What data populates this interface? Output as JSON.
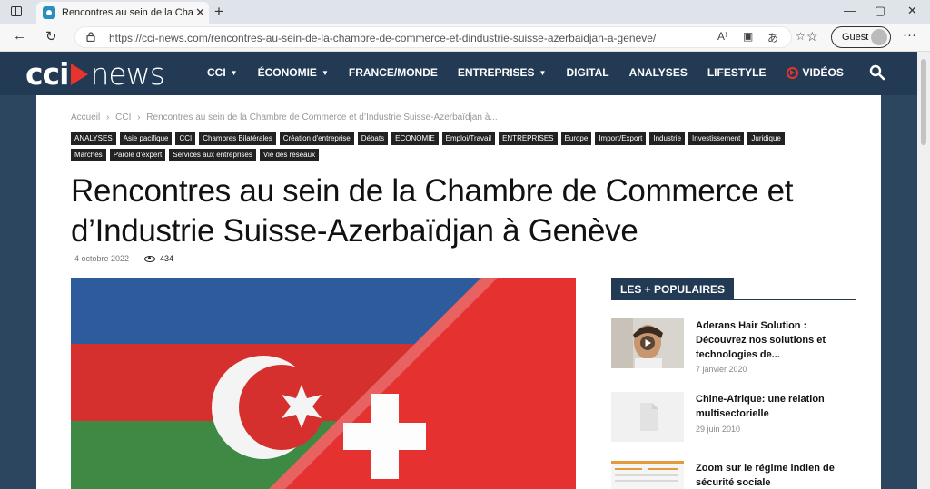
{
  "browser": {
    "tab_title": "Rencontres au sein de la Chambr",
    "url": "https://cci-news.com/rencontres-au-sein-de-la-chambre-de-commerce-et-dindustrie-suisse-azerbaidjan-a-geneve/",
    "profile_label": "Guest"
  },
  "site": {
    "logo_cci": "cci",
    "logo_news": "news",
    "menu": [
      {
        "label": "CCI",
        "dropdown": true
      },
      {
        "label": "ÉCONOMIE",
        "dropdown": true
      },
      {
        "label": "FRANCE/MONDE",
        "dropdown": false
      },
      {
        "label": "ENTREPRISES",
        "dropdown": true
      },
      {
        "label": "DIGITAL",
        "dropdown": false
      },
      {
        "label": "ANALYSES",
        "dropdown": false
      },
      {
        "label": "LIFESTYLE",
        "dropdown": false
      },
      {
        "label": "VIDÉOS",
        "dropdown": false
      }
    ]
  },
  "article": {
    "breadcrumb": [
      "Accueil",
      "CCI",
      "Rencontres au sein de la Chambre de Commerce et d’Industrie Suisse-Azerbaïdjan à..."
    ],
    "breadcrumb_sep": "›",
    "tags": [
      "ANALYSES",
      "Asie pacifique",
      "CCI",
      "Chambres Bilatérales",
      "Création d'entreprise",
      "Débats",
      "ECONOMIE",
      "Emploi/Travail",
      "ENTREPRISES",
      "Europe",
      "Import/Export",
      "Industrie",
      "Investissement",
      "Juridique",
      "Marchés",
      "Parole d'expert",
      "Services aux entreprises",
      "Vie des réseaux"
    ],
    "title": "Rencontres au sein de la Chambre de Commerce et d’Industrie Suisse-Azerbaïdjan à Genève",
    "date": "4 octobre 2022",
    "views": "434"
  },
  "sidebar": {
    "heading": "LES + POPULAIRES",
    "items": [
      {
        "title": "Aderans Hair Solution : Découvrez nos solutions et technologies de...",
        "date": "7 janvier 2020"
      },
      {
        "title": "Chine-Afrique: une relation multisectorielle",
        "date": "29 juin 2010"
      },
      {
        "title": "Zoom sur le régime indien de sécurité sociale",
        "date": ""
      }
    ]
  },
  "colors": {
    "header_bg": "#233a55",
    "page_bg": "#2d4660",
    "accent_red": "#e7352d"
  }
}
